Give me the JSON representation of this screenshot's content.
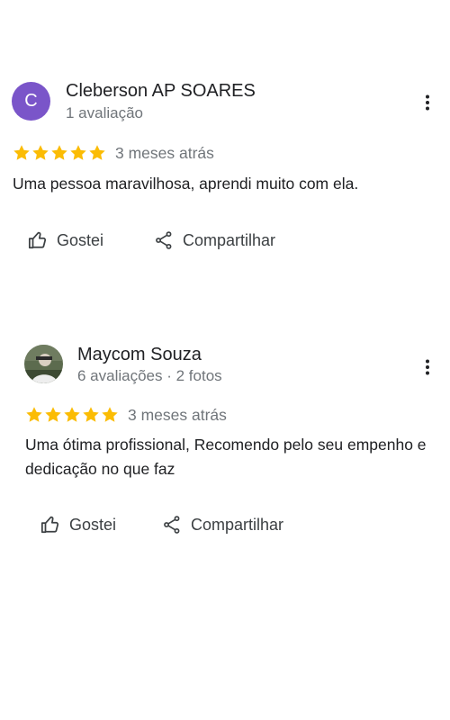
{
  "reviews": [
    {
      "avatar_initial": "C",
      "avatar_color": "#7a55c9",
      "author": "Cleberson AP SOARES",
      "meta": "1 avaliação",
      "stars": 5,
      "date": "3 meses atrás",
      "text": "Uma pessoa maravilhosa, aprendi muito com ela.",
      "like_label": "Gostei",
      "share_label": "Compartilhar"
    },
    {
      "avatar_initial": "",
      "author": "Maycom Souza",
      "meta": "6 avaliações · 2 fotos",
      "stars": 5,
      "date": "3 meses atrás",
      "text": "Uma ótima profissional, Recomendo pelo seu empenho e dedicação no que faz",
      "like_label": "Gostei",
      "share_label": "Compartilhar"
    }
  ],
  "colors": {
    "star": "#fbbc04",
    "secondary_text": "#70757a",
    "primary_text": "#202124"
  },
  "icons": {
    "more": "more-vert-icon",
    "like": "thumb-up-icon",
    "share": "share-icon",
    "star": "star-icon"
  }
}
